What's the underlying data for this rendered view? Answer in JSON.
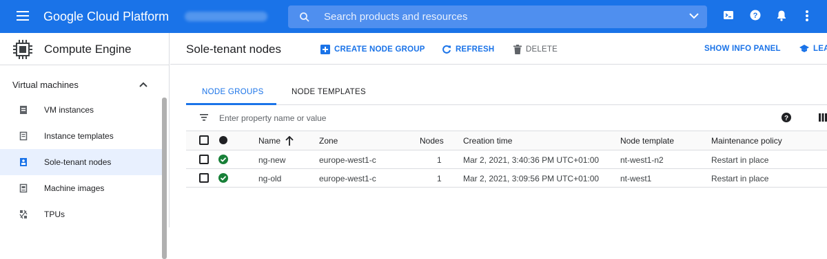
{
  "header": {
    "brand": "Google Cloud Platform",
    "search_placeholder": "Search products and resources"
  },
  "sidebar": {
    "title": "Compute Engine",
    "section": "Virtual machines",
    "items": [
      {
        "label": "VM instances",
        "icon": "vm-icon"
      },
      {
        "label": "Instance templates",
        "icon": "template-icon"
      },
      {
        "label": "Sole-tenant nodes",
        "icon": "sole-tenant-icon",
        "active": true
      },
      {
        "label": "Machine images",
        "icon": "machine-image-icon"
      },
      {
        "label": "TPUs",
        "icon": "tpu-icon"
      }
    ]
  },
  "toolbar": {
    "page_title": "Sole-tenant nodes",
    "create_label": "CREATE NODE GROUP",
    "refresh_label": "REFRESH",
    "delete_label": "DELETE",
    "info_panel_label": "SHOW INFO PANEL",
    "learn_label": "LEA"
  },
  "tabs": [
    {
      "label": "NODE GROUPS",
      "active": true
    },
    {
      "label": "NODE TEMPLATES",
      "active": false
    }
  ],
  "filter": {
    "placeholder": "Enter property name or value"
  },
  "table": {
    "columns": [
      "Name",
      "Zone",
      "Nodes",
      "Creation time",
      "Node template",
      "Maintenance policy"
    ],
    "rows": [
      {
        "name": "ng-new",
        "zone": "europe-west1-c",
        "nodes": "1",
        "created": "Mar 2, 2021, 3:40:36 PM UTC+01:00",
        "template": "nt-west1-n2",
        "policy": "Restart in place",
        "status": "ok"
      },
      {
        "name": "ng-old",
        "zone": "europe-west1-c",
        "nodes": "1",
        "created": "Mar 2, 2021, 3:09:56 PM UTC+01:00",
        "template": "nt-west1",
        "policy": "Restart in place",
        "status": "ok"
      }
    ]
  },
  "colors": {
    "accent": "#1a73e8",
    "status_ok": "#188038"
  }
}
